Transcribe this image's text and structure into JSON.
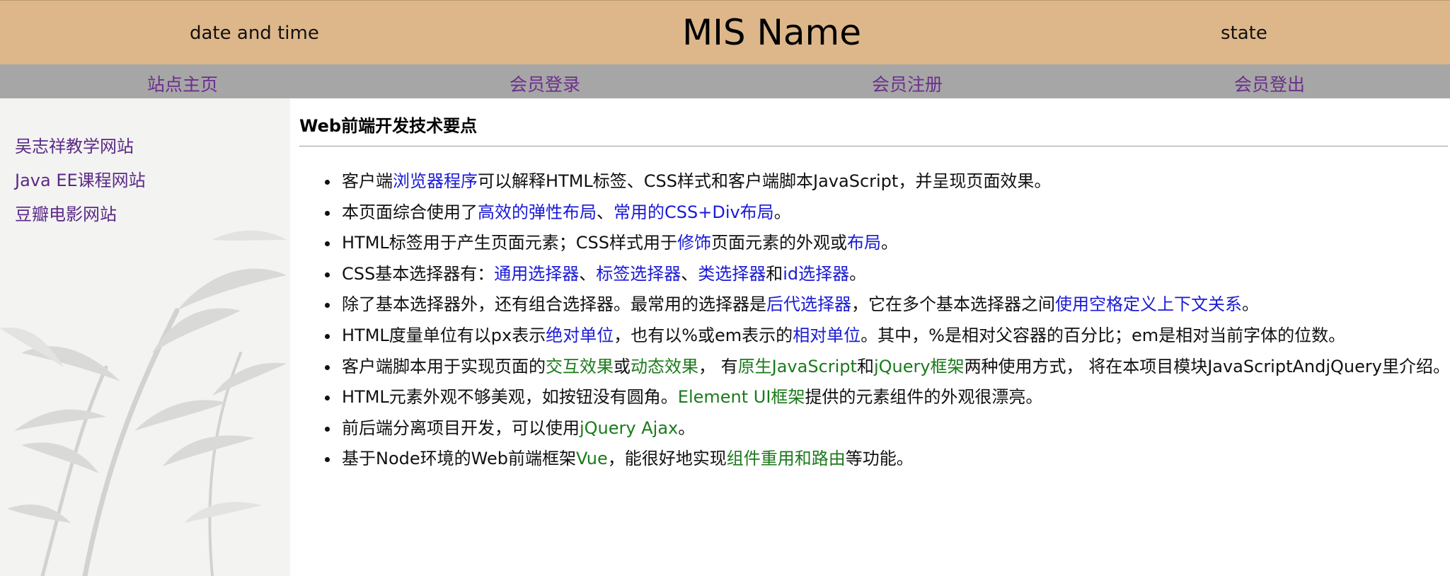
{
  "header": {
    "date_time": "date and time",
    "title": "MIS Name",
    "state": "state"
  },
  "nav": {
    "items": [
      {
        "label": "站点主页"
      },
      {
        "label": "会员登录"
      },
      {
        "label": "会员注册"
      },
      {
        "label": "会员登出"
      }
    ]
  },
  "sidebar": {
    "links": [
      {
        "label": "吴志祥教学网站"
      },
      {
        "label": "Java EE课程网站"
      },
      {
        "label": "豆瓣电影网站"
      }
    ]
  },
  "main": {
    "title": "Web前端开发技术要点",
    "points": [
      [
        {
          "text": "客户端"
        },
        {
          "text": "浏览器程序",
          "link": "blue"
        },
        {
          "text": "可以解释HTML标签、CSS样式和客户端脚本JavaScript，并呈现页面效果。"
        }
      ],
      [
        {
          "text": "本页面综合使用了"
        },
        {
          "text": "高效的弹性布局",
          "link": "blue"
        },
        {
          "text": "、"
        },
        {
          "text": "常用的CSS+Div布局",
          "link": "blue"
        },
        {
          "text": "。"
        }
      ],
      [
        {
          "text": "HTML标签用于产生页面元素；CSS样式用于"
        },
        {
          "text": "修饰",
          "link": "blue"
        },
        {
          "text": "页面元素的外观或"
        },
        {
          "text": "布局",
          "link": "blue"
        },
        {
          "text": "。"
        }
      ],
      [
        {
          "text": "CSS基本选择器有："
        },
        {
          "text": "通用选择器",
          "link": "blue"
        },
        {
          "text": "、"
        },
        {
          "text": "标签选择器",
          "link": "blue"
        },
        {
          "text": "、"
        },
        {
          "text": "类选择器",
          "link": "blue"
        },
        {
          "text": "和"
        },
        {
          "text": "id选择器",
          "link": "blue"
        },
        {
          "text": "。"
        }
      ],
      [
        {
          "text": "除了基本选择器外，还有组合选择器。最常用的选择器是"
        },
        {
          "text": "后代选择器",
          "link": "blue"
        },
        {
          "text": "，它在多个基本选择器之间"
        },
        {
          "text": "使用空格定义上下文关系",
          "link": "blue"
        },
        {
          "text": "。"
        }
      ],
      [
        {
          "text": "HTML度量单位有以px表示"
        },
        {
          "text": "绝对单位",
          "link": "blue"
        },
        {
          "text": "，也有以%或em表示的"
        },
        {
          "text": "相对单位",
          "link": "blue"
        },
        {
          "text": "。其中，%是相对父容器的百分比；em是相对当前字体的位数。"
        }
      ],
      [
        {
          "text": "客户端脚本用于实现页面的"
        },
        {
          "text": "交互效果",
          "link": "green"
        },
        {
          "text": "或"
        },
        {
          "text": "动态效果",
          "link": "green"
        },
        {
          "text": "， 有"
        },
        {
          "text": "原生JavaScript",
          "link": "green"
        },
        {
          "text": "和"
        },
        {
          "text": "jQuery框架",
          "link": "green"
        },
        {
          "text": "两种使用方式， 将在本项目模块JavaScriptAndjQuery里介绍。"
        }
      ],
      [
        {
          "text": "HTML元素外观不够美观，如按钮没有圆角。"
        },
        {
          "text": "Element UI框架",
          "link": "green"
        },
        {
          "text": "提供的元素组件的外观很漂亮。"
        }
      ],
      [
        {
          "text": "前后端分离项目开发，可以使用"
        },
        {
          "text": "jQuery Ajax",
          "link": "green"
        },
        {
          "text": "。"
        }
      ],
      [
        {
          "text": "基于Node环境的Web前端框架"
        },
        {
          "text": "Vue",
          "link": "green"
        },
        {
          "text": "，能很好地实现"
        },
        {
          "text": "组件重用和路由",
          "link": "green"
        },
        {
          "text": "等功能。"
        }
      ]
    ]
  },
  "colors": {
    "header_bg": "#ddb78a",
    "nav_bg": "#a6a6a6",
    "nav_link": "#6b2f8c",
    "link_blue": "#1a1ad6",
    "link_green": "#1b7a1b"
  }
}
